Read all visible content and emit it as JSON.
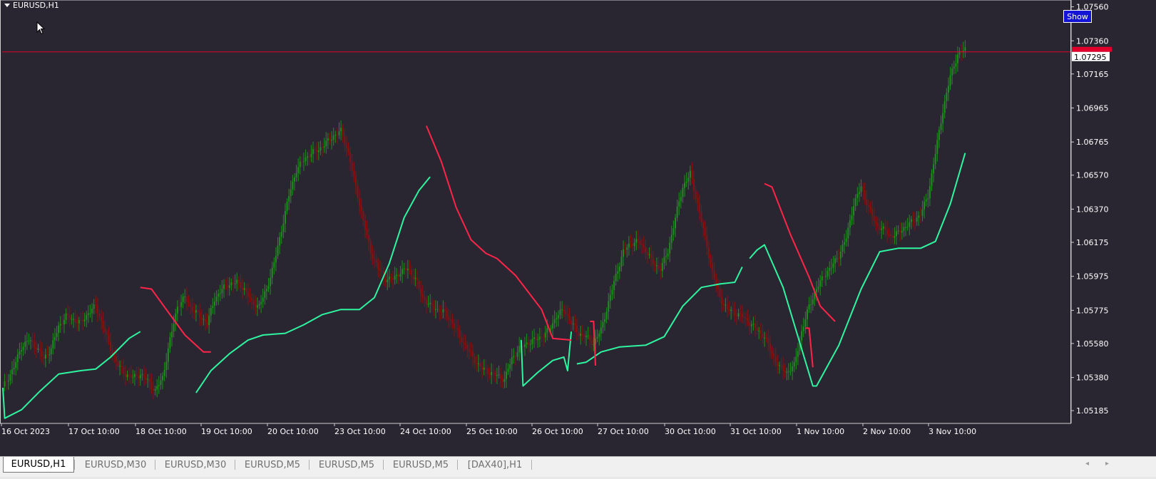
{
  "window": {
    "symbol_title": "EURUSD,H1"
  },
  "show_button": {
    "label": "Show"
  },
  "price_line": {
    "value": 1.07295,
    "label": "1.07295",
    "color": "#e0002a"
  },
  "colors": {
    "background": "#2a2631",
    "bull_candle": "#1e8f1e",
    "bear_candle": "#8b1010",
    "trail_up": "#2ef5a0",
    "trail_down": "#ff2448",
    "axis_text": "#ffffff"
  },
  "chart_data": {
    "type": "candlestick",
    "y_ticks": [
      "1.07560",
      "1.07360",
      "1.07165",
      "1.06965",
      "1.06765",
      "1.06570",
      "1.06370",
      "1.06175",
      "1.05975",
      "1.05775",
      "1.05580",
      "1.05380",
      "1.05185"
    ],
    "x_ticks": [
      "16 Oct 2023",
      "17 Oct 10:00",
      "18 Oct 10:00",
      "19 Oct 10:00",
      "20 Oct 10:00",
      "23 Oct 10:00",
      "24 Oct 10:00",
      "25 Oct 10:00",
      "26 Oct 10:00",
      "27 Oct 10:00",
      "30 Oct 10:00",
      "31 Oct 10:00",
      "1 Nov 10:00",
      "2 Nov 10:00",
      "3 Nov 10:00"
    ],
    "ylim": [
      1.0511,
      1.076
    ],
    "price_path": [
      [
        0,
        1.0532
      ],
      [
        6,
        1.0544
      ],
      [
        10,
        1.0556
      ],
      [
        14,
        1.056
      ],
      [
        18,
        1.0556
      ],
      [
        22,
        1.0549
      ],
      [
        26,
        1.0555
      ],
      [
        30,
        1.0568
      ],
      [
        34,
        1.0574
      ],
      [
        38,
        1.0572
      ],
      [
        42,
        1.057
      ],
      [
        46,
        1.0576
      ],
      [
        50,
        1.058
      ],
      [
        54,
        1.0568
      ],
      [
        58,
        1.0555
      ],
      [
        62,
        1.0545
      ],
      [
        66,
        1.054
      ],
      [
        70,
        1.0538
      ],
      [
        74,
        1.054
      ],
      [
        78,
        1.0536
      ],
      [
        82,
        1.053
      ],
      [
        86,
        1.0538
      ],
      [
        90,
        1.056
      ],
      [
        94,
        1.058
      ],
      [
        98,
        1.0585
      ],
      [
        102,
        1.0578
      ],
      [
        106,
        1.0574
      ],
      [
        110,
        1.057
      ],
      [
        114,
        1.0584
      ],
      [
        118,
        1.059
      ],
      [
        122,
        1.0593
      ],
      [
        126,
        1.0594
      ],
      [
        130,
        1.059
      ],
      [
        134,
        1.0582
      ],
      [
        138,
        1.058
      ],
      [
        142,
        1.059
      ],
      [
        146,
        1.0605
      ],
      [
        150,
        1.0625
      ],
      [
        154,
        1.0645
      ],
      [
        158,
        1.066
      ],
      [
        162,
        1.0666
      ],
      [
        166,
        1.067
      ],
      [
        170,
        1.0672
      ],
      [
        174,
        1.0676
      ],
      [
        178,
        1.068
      ],
      [
        182,
        1.0683
      ],
      [
        186,
        1.067
      ],
      [
        190,
        1.065
      ],
      [
        194,
        1.063
      ],
      [
        198,
        1.0612
      ],
      [
        202,
        1.0602
      ],
      [
        206,
        1.0596
      ],
      [
        210,
        1.0596
      ],
      [
        214,
        1.06
      ],
      [
        218,
        1.0602
      ],
      [
        222,
        1.0596
      ],
      [
        226,
        1.0585
      ],
      [
        230,
        1.058
      ],
      [
        234,
        1.0578
      ],
      [
        238,
        1.0576
      ],
      [
        242,
        1.057
      ],
      [
        246,
        1.0562
      ],
      [
        250,
        1.0555
      ],
      [
        254,
        1.0548
      ],
      [
        258,
        1.0543
      ],
      [
        262,
        1.0541
      ],
      [
        266,
        1.0539
      ],
      [
        270,
        1.0537
      ],
      [
        274,
        1.0549
      ],
      [
        278,
        1.0555
      ],
      [
        282,
        1.0558
      ],
      [
        286,
        1.056
      ],
      [
        290,
        1.0562
      ],
      [
        294,
        1.0566
      ],
      [
        298,
        1.0574
      ],
      [
        302,
        1.0578
      ],
      [
        306,
        1.057
      ],
      [
        310,
        1.0564
      ],
      [
        314,
        1.0562
      ],
      [
        318,
        1.0558
      ],
      [
        322,
        1.0566
      ],
      [
        326,
        1.0582
      ],
      [
        330,
        1.0598
      ],
      [
        334,
        1.0612
      ],
      [
        338,
        1.0617
      ],
      [
        342,
        1.0618
      ],
      [
        346,
        1.0613
      ],
      [
        350,
        1.0605
      ],
      [
        354,
        1.0602
      ],
      [
        358,
        1.0612
      ],
      [
        362,
        1.0632
      ],
      [
        366,
        1.065
      ],
      [
        370,
        1.0658
      ],
      [
        374,
        1.064
      ],
      [
        378,
        1.062
      ],
      [
        382,
        1.06
      ],
      [
        386,
        1.0585
      ],
      [
        390,
        1.0578
      ],
      [
        394,
        1.0576
      ],
      [
        398,
        1.0574
      ],
      [
        402,
        1.057
      ],
      [
        406,
        1.0566
      ],
      [
        410,
        1.0562
      ],
      [
        414,
        1.0552
      ],
      [
        418,
        1.0544
      ],
      [
        422,
        1.0541
      ],
      [
        426,
        1.0545
      ],
      [
        430,
        1.0565
      ],
      [
        434,
        1.058
      ],
      [
        438,
        1.059
      ],
      [
        442,
        1.0598
      ],
      [
        446,
        1.0603
      ],
      [
        450,
        1.061
      ],
      [
        454,
        1.062
      ],
      [
        458,
        1.064
      ],
      [
        462,
        1.065
      ],
      [
        466,
        1.0638
      ],
      [
        470,
        1.0628
      ],
      [
        474,
        1.0625
      ],
      [
        478,
        1.0621
      ],
      [
        482,
        1.0623
      ],
      [
        486,
        1.0627
      ],
      [
        490,
        1.063
      ],
      [
        494,
        1.0634
      ],
      [
        498,
        1.0645
      ],
      [
        502,
        1.067
      ],
      [
        506,
        1.0695
      ],
      [
        510,
        1.0715
      ],
      [
        514,
        1.0728
      ],
      [
        518,
        1.0731
      ]
    ],
    "trailing_stop": {
      "up": [
        [
          [
            0,
            1.0532
          ],
          [
            1,
            1.0514
          ],
          [
            10,
            1.0519
          ],
          [
            20,
            1.053
          ],
          [
            30,
            1.054
          ],
          [
            42,
            1.0542
          ],
          [
            50,
            1.0543
          ],
          [
            58,
            1.055
          ],
          [
            68,
            1.0561
          ],
          [
            74,
            1.0565
          ]
        ],
        [
          [
            104,
            1.0529
          ],
          [
            112,
            1.0542
          ],
          [
            122,
            1.0552
          ],
          [
            132,
            1.056
          ],
          [
            140,
            1.0563
          ],
          [
            152,
            1.0564
          ],
          [
            162,
            1.0569
          ],
          [
            172,
            1.0575
          ],
          [
            182,
            1.0578
          ],
          [
            192,
            1.0578
          ],
          [
            200,
            1.0585
          ],
          [
            208,
            1.0605
          ],
          [
            216,
            1.0632
          ],
          [
            224,
            1.0648
          ],
          [
            230,
            1.0656
          ]
        ],
        [
          [
            279,
            1.056
          ],
          [
            280,
            1.0533
          ],
          [
            288,
            1.0541
          ],
          [
            296,
            1.0548
          ],
          [
            302,
            1.055
          ],
          [
            304,
            1.0542
          ],
          [
            306,
            1.0565
          ]
        ],
        [
          [
            309,
            1.0546
          ],
          [
            314,
            1.0547
          ],
          [
            322,
            1.0553
          ],
          [
            332,
            1.0556
          ],
          [
            346,
            1.0557
          ],
          [
            356,
            1.0562
          ],
          [
            366,
            1.058
          ],
          [
            376,
            1.0591
          ],
          [
            386,
            1.0593
          ],
          [
            394,
            1.0594
          ],
          [
            398,
            1.0603
          ]
        ],
        [
          [
            402,
            1.0608
          ],
          [
            406,
            1.0613
          ],
          [
            410,
            1.0616
          ],
          [
            420,
            1.0591
          ],
          [
            436,
            1.0533
          ],
          [
            438,
            1.0533
          ],
          [
            450,
            1.0557
          ],
          [
            462,
            1.059
          ],
          [
            472,
            1.0612
          ],
          [
            482,
            1.0614
          ],
          [
            494,
            1.0614
          ],
          [
            502,
            1.0618
          ],
          [
            510,
            1.064
          ],
          [
            518,
            1.067
          ]
        ]
      ],
      "down": [
        [
          [
            74,
            1.0591
          ],
          [
            80,
            1.059
          ],
          [
            88,
            1.0578
          ],
          [
            98,
            1.0563
          ],
          [
            108,
            1.0553
          ],
          [
            112,
            1.0553
          ]
        ],
        [
          [
            228,
            1.0686
          ],
          [
            236,
            1.0665
          ],
          [
            244,
            1.0638
          ],
          [
            252,
            1.0619
          ],
          [
            260,
            1.0611
          ],
          [
            266,
            1.0608
          ],
          [
            276,
            1.0598
          ],
          [
            290,
            1.0578
          ],
          [
            296,
            1.0561
          ],
          [
            306,
            1.056
          ]
        ],
        [
          [
            316,
            1.0571
          ],
          [
            318,
            1.0571
          ],
          [
            319,
            1.0545
          ]
        ],
        [
          [
            432,
            1.0567
          ],
          [
            434,
            1.0567
          ],
          [
            436,
            1.0544
          ]
        ],
        [
          [
            410,
            1.0652
          ],
          [
            414,
            1.065
          ],
          [
            424,
            1.0622
          ],
          [
            434,
            1.0597
          ],
          [
            440,
            1.058
          ],
          [
            448,
            1.0571
          ]
        ]
      ]
    }
  },
  "tabs": [
    {
      "label": "EURUSD,H1",
      "active": true
    },
    {
      "label": "EURUSD,M30",
      "active": false
    },
    {
      "label": "EURUSD,M30",
      "active": false
    },
    {
      "label": "EURUSD,M5",
      "active": false
    },
    {
      "label": "EURUSD,M5",
      "active": false
    },
    {
      "label": "EURUSD,M5",
      "active": false
    },
    {
      "label": "[DAX40],H1",
      "active": false
    }
  ],
  "scroll": {
    "left_icon": "chevron-left-icon",
    "right_icon": "chevron-right-icon",
    "left_glyph": "◂",
    "right_glyph": "▸"
  }
}
